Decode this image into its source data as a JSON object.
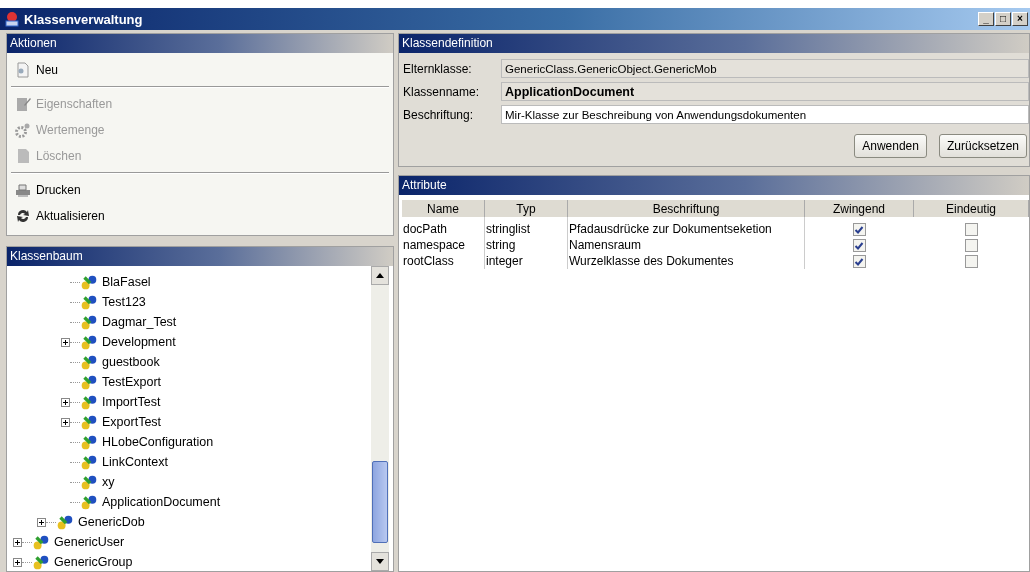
{
  "window": {
    "title": "Klassenverwaltung",
    "controls": [
      "_",
      "□",
      "×"
    ]
  },
  "actions": {
    "title": "Aktionen",
    "items": [
      {
        "label": "Neu",
        "kind": "new",
        "disabled": false,
        "separator_after": true
      },
      {
        "label": "Eigenschaften",
        "kind": "properties",
        "disabled": true,
        "separator_after": false
      },
      {
        "label": "Wertemenge",
        "kind": "values",
        "disabled": true,
        "separator_after": false
      },
      {
        "label": "Löschen",
        "kind": "delete",
        "disabled": true,
        "separator_after": true
      },
      {
        "label": "Drucken",
        "kind": "print",
        "disabled": false,
        "separator_after": false
      },
      {
        "label": "Aktualisieren",
        "kind": "refresh",
        "disabled": false,
        "separator_after": false
      }
    ]
  },
  "tree": {
    "title": "Klassenbaum",
    "items": [
      {
        "children": [
          {
            "children": [
              {
                "label": "BlaFasel"
              },
              {
                "label": "Test123"
              },
              {
                "label": "Dagmar_Test"
              },
              {
                "label": "Development",
                "expanded": false
              },
              {
                "label": "guestbook"
              },
              {
                "label": "TestExport"
              },
              {
                "label": "ImportTest",
                "expanded": false
              },
              {
                "label": "ExportTest",
                "expanded": false
              },
              {
                "label": "HLobeConfiguration"
              },
              {
                "label": "LinkContext"
              },
              {
                "label": "xy"
              },
              {
                "label": "ApplicationDocument"
              }
            ]
          },
          {
            "label": "GenericDob",
            "expanded": false
          }
        ]
      },
      {
        "label": "GenericUser",
        "expanded": false
      },
      {
        "label": "GenericGroup",
        "expanded": false
      }
    ]
  },
  "definition": {
    "title": "Klassendefinition",
    "fields": [
      {
        "label": "Elternklasse:",
        "value": "GenericClass.GenericObject.GenericMob",
        "editable": false,
        "bold": false
      },
      {
        "label": "Klassenname:",
        "value": "ApplicationDocument",
        "editable": false,
        "bold": true
      },
      {
        "label": "Beschriftung:",
        "value": "Mir-Klasse zur Beschreibung von Anwendungsdokumenten",
        "editable": true,
        "bold": false
      }
    ],
    "buttons": [
      "Anwenden",
      "Zurücksetzen"
    ]
  },
  "attributes": {
    "title": "Attribute",
    "columns": [
      "Name",
      "Typ",
      "Beschriftung",
      "Zwingend",
      "Eindeutig"
    ],
    "rows": [
      {
        "name": "docPath",
        "type": "stringlist",
        "caption": "Pfadausdrücke zur Dokumentseketion",
        "required": true,
        "unique": false
      },
      {
        "name": "namespace",
        "type": "string",
        "caption": "Namensraum",
        "required": true,
        "unique": false
      },
      {
        "name": "rootClass",
        "type": "integer",
        "caption": "Wurzelklasse des Dokumentes",
        "required": true,
        "unique": false
      }
    ]
  }
}
